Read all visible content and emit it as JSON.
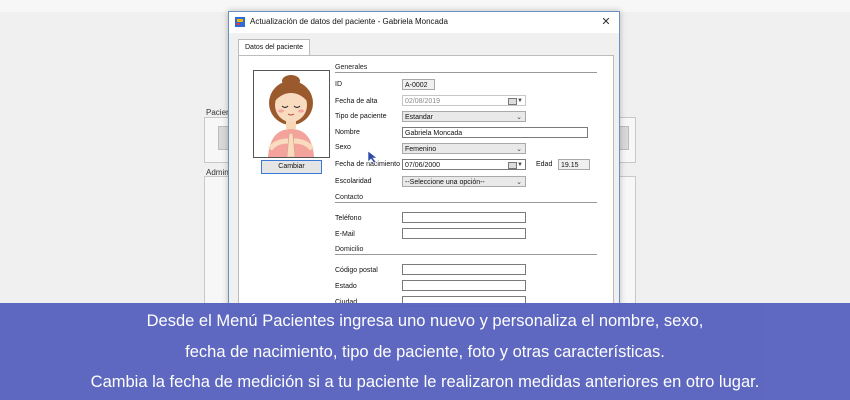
{
  "background": {
    "label_pacientes": "Paciente",
    "label_administracion": "Administ"
  },
  "dialog": {
    "title": "Actualización de datos del paciente - Gabriela Moncada",
    "close_glyph": "✕",
    "tab_label": "Datos del paciente",
    "change_photo_label": "Cambiar"
  },
  "form": {
    "section_generales": "Generales",
    "section_contacto": "Contacto",
    "section_domicilio": "Domicilio",
    "id_label": "ID",
    "id_value": "A-0002",
    "fecha_alta_label": "Fecha de alta",
    "fecha_alta_value": "02/08/2019",
    "tipo_label": "Tipo de paciente",
    "tipo_value": "Estandar",
    "nombre_label": "Nombre",
    "nombre_value": "Gabriela Moncada",
    "sexo_label": "Sexo",
    "sexo_value": "Femenino",
    "fecha_nac_label": "Fecha de nacimiento",
    "fecha_nac_value": "07/06/2000",
    "edad_label": "Edad",
    "edad_value": "19.15",
    "escolaridad_label": "Escolaridad",
    "escolaridad_value": "--Seleccione una opción--",
    "telefono_label": "Teléfono",
    "telefono_value": "",
    "email_label": "E-Mail",
    "email_value": "",
    "cp_label": "Código postal",
    "cp_value": "",
    "estado_label": "Estado",
    "estado_value": "",
    "ciudad_label": "Ciudad",
    "ciudad_value": ""
  },
  "caption": {
    "line1": "Desde el Menú Pacientes ingresa uno nuevo y personaliza el nombre, sexo,",
    "line2": "fecha de nacimiento, tipo de paciente, foto y otras características.",
    "line3": "Cambia la fecha de medición si a tu paciente le realizaron medidas anteriores en otro lugar."
  },
  "icons": [
    "app-icon",
    "close-icon",
    "avatar-photo",
    "calendar-icon",
    "dropdown-arrow-icon",
    "mouse-cursor-icon"
  ]
}
